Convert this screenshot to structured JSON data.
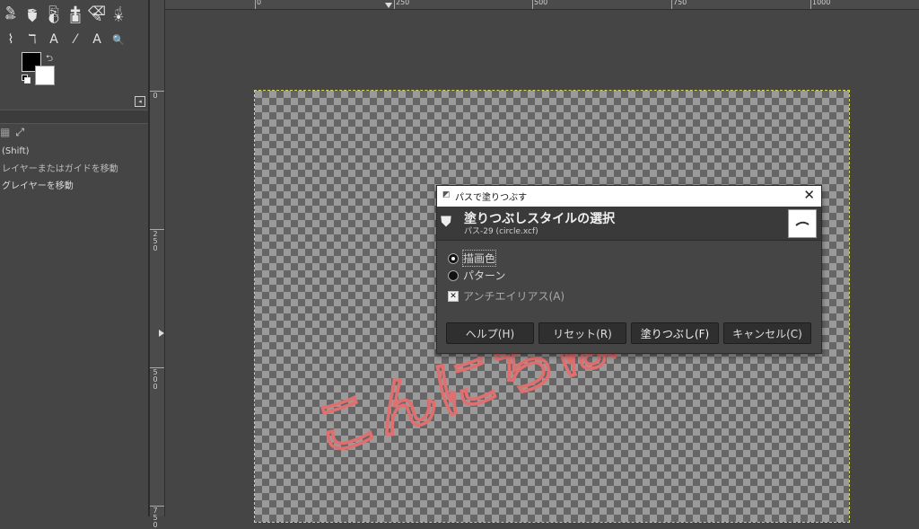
{
  "toolbox": {
    "row1_icons": [
      "airbrush-icon",
      "ink-icon",
      "clone-icon",
      "heal-icon",
      "eraser-icon",
      "smudge-icon"
    ],
    "row2_icons": [
      "pencil-icon",
      "paintbucket-icon",
      "gradient-icon",
      "perspective-clone-icon",
      "text-tool-icon",
      "dodge-icon"
    ],
    "row3_icons": [
      "brush-icon",
      "paths-tool-icon",
      "text-icon",
      "color-picker-icon",
      "measure-icon",
      "zoom-icon"
    ],
    "row1_glyphs": [
      "✎",
      "✒",
      "⎘",
      "✚",
      "⌫",
      "☝"
    ],
    "row2_glyphs": [
      "✏",
      "⛊",
      "◐",
      "▣",
      "✎",
      "☀"
    ],
    "row3_glyphs": [
      "⌇",
      "ℸ",
      "A",
      "⁄",
      "A",
      "🔍"
    ],
    "fg_color": "#000000",
    "bg_color": "#ffffff",
    "options": {
      "line1": "(Shift)",
      "line2": "レイヤーまたはガイドを移動",
      "line3": "グレイヤーを移動"
    }
  },
  "rulers": {
    "h_labels": [
      "0",
      "250",
      "500",
      "750",
      "1000"
    ],
    "v_labels": [
      "0",
      "250",
      "500",
      "750"
    ]
  },
  "dialog": {
    "window_title": "パスで塗りつぶす",
    "header_title": "塗りつぶしスタイルの選択",
    "header_subtitle": "パス-29 (circle.xcf)",
    "options": {
      "fg_color_label": "描画色",
      "pattern_label": "パターン",
      "antialias_label": "アンチエイリアス(A)"
    },
    "buttons": {
      "help": "ヘルプ(H)",
      "reset": "リセット(R)",
      "fill": "塗りつぶし(F)",
      "cancel": "キャンセル(C)"
    }
  },
  "canvas": {
    "path_text": "こんにちは",
    "path_color": "#e07070"
  }
}
